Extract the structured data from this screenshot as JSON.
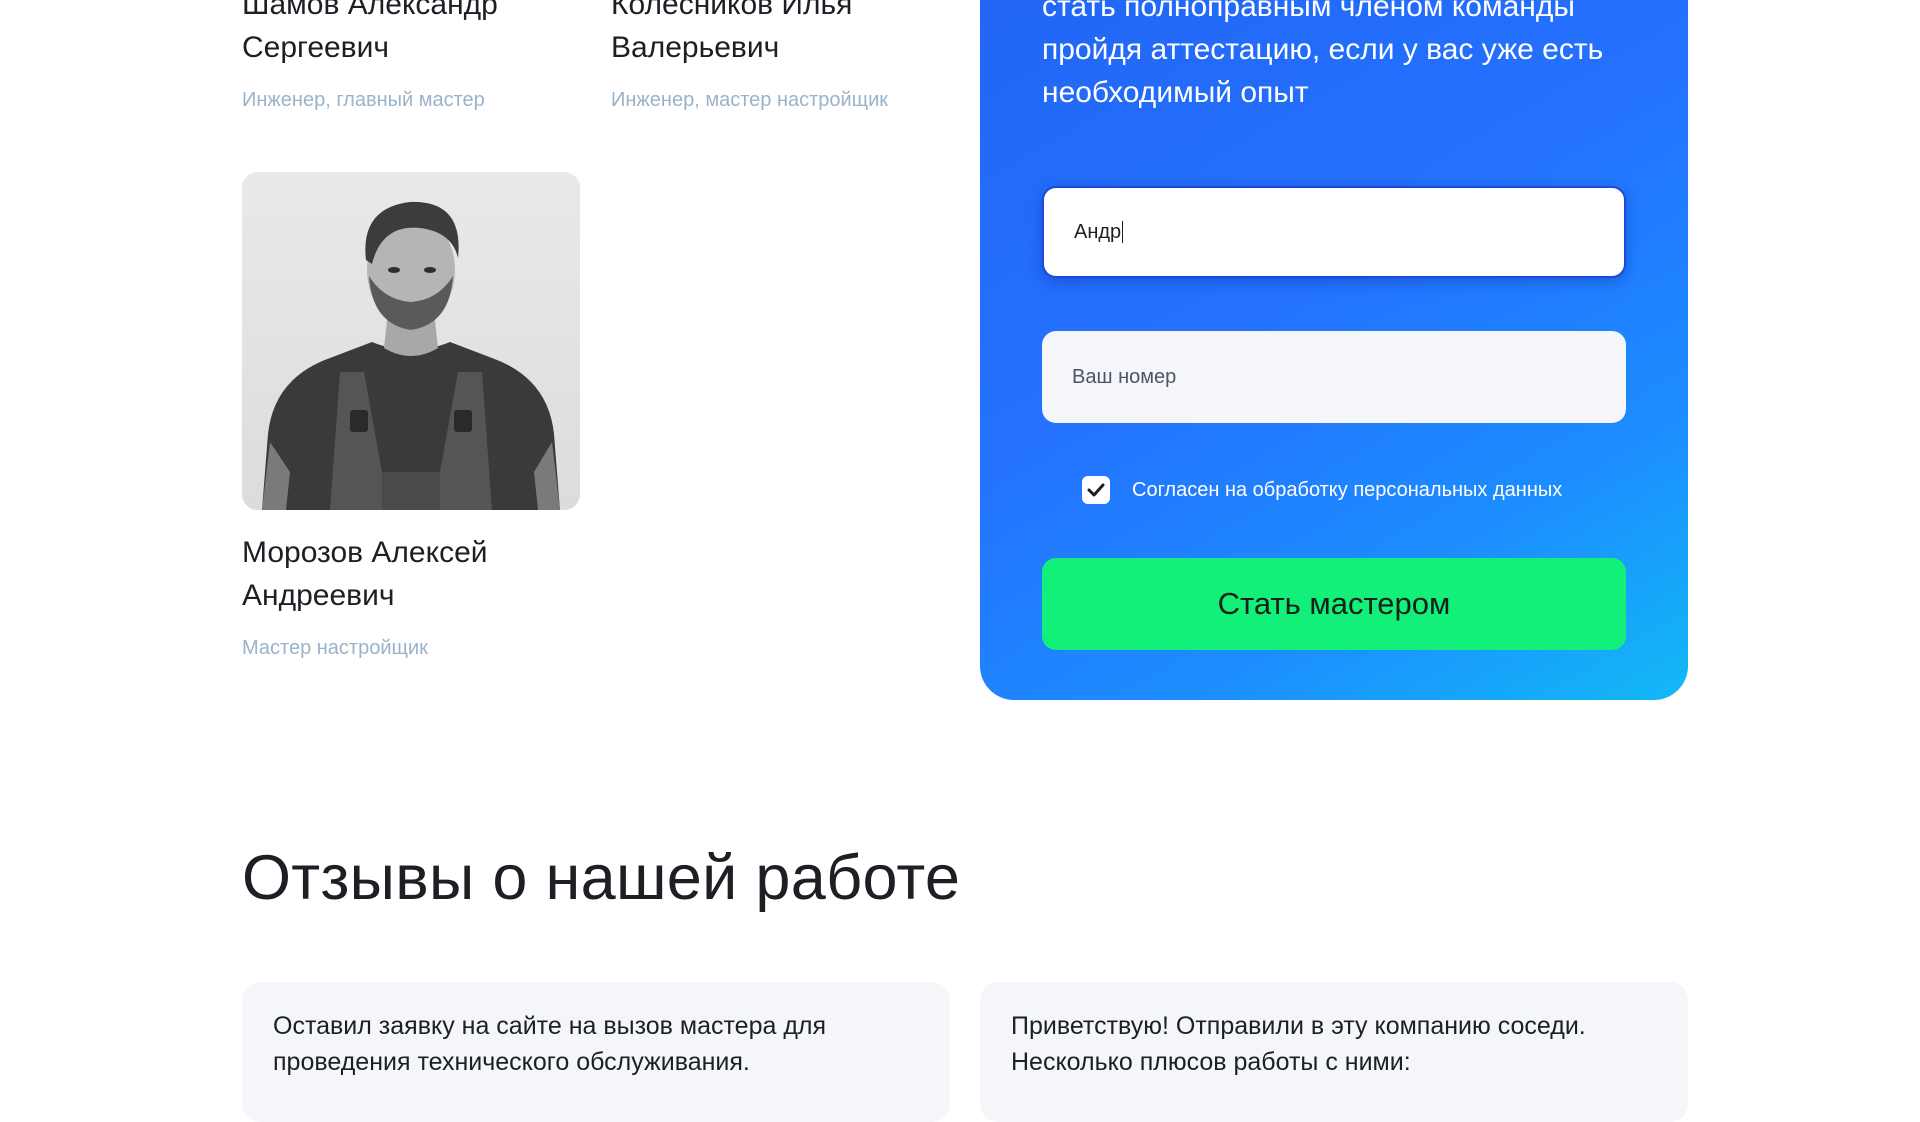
{
  "team": {
    "members": [
      {
        "name": "Шамов Александр Сергеевич",
        "role": "Инженер, главный мастер"
      },
      {
        "name": "Колесников Илья Валерьевич",
        "role": "Инженер, мастер настройщик"
      },
      {
        "name": "Морозов Алексей Андреевич",
        "role": "Мастер настройщик"
      }
    ]
  },
  "join_form": {
    "intro_text": "стать полноправным членом команды пройдя аттестацию, если у вас уже есть необходимый опыт",
    "name_value": "Андр",
    "phone_placeholder": "Ваш номер",
    "consent_label": "Согласен на обработку персональных данных",
    "consent_checked": true,
    "submit_label": "Стать мастером",
    "colors": {
      "gradient_start": "#2265f5",
      "gradient_end": "#12b9f5",
      "button": "#12f07a"
    }
  },
  "reviews": {
    "title": "Отзывы о нашей работе",
    "items": [
      {
        "text": "Оставил заявку на сайте на вызов мастера для проведения технического обслуживания."
      },
      {
        "text": "Приветствую! Отправили в эту компанию соседи. Несколько плюсов работы с ними:"
      }
    ]
  }
}
